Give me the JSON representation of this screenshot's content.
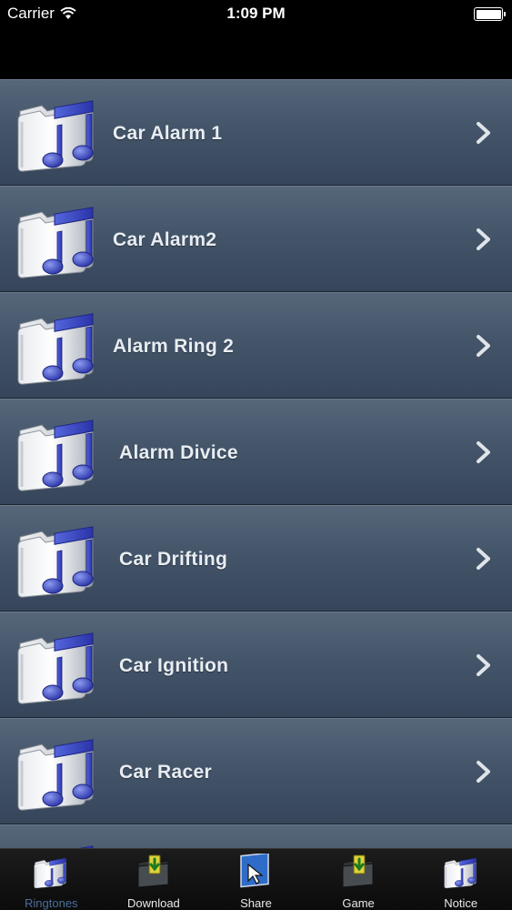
{
  "status_bar": {
    "carrier": "Carrier",
    "time": "1:09 PM",
    "icons": {
      "wifi": "wifi-icon",
      "battery": "battery-icon"
    }
  },
  "list": {
    "items": [
      {
        "label": "Car Alarm 1",
        "icon": "music-folder-icon",
        "chevron": "chevron-right-icon"
      },
      {
        "label": "Car Alarm2",
        "icon": "music-folder-icon",
        "chevron": "chevron-right-icon"
      },
      {
        "label": "Alarm Ring 2",
        "icon": "music-folder-icon",
        "chevron": "chevron-right-icon"
      },
      {
        "label": "Alarm Divice",
        "icon": "music-folder-icon",
        "chevron": "chevron-right-icon"
      },
      {
        "label": "Car Drifting",
        "icon": "music-folder-icon",
        "chevron": "chevron-right-icon"
      },
      {
        "label": "Car Ignition",
        "icon": "music-folder-icon",
        "chevron": "chevron-right-icon"
      },
      {
        "label": "Car Racer",
        "icon": "music-folder-icon",
        "chevron": "chevron-right-icon"
      },
      {
        "label": "",
        "icon": "music-folder-icon",
        "chevron": "chevron-right-icon"
      }
    ]
  },
  "tab_bar": {
    "active": "Ringtones",
    "tabs": [
      {
        "label": "Ringtones",
        "icon": "music-folder-icon"
      },
      {
        "label": "Download",
        "icon": "download-folder-icon"
      },
      {
        "label": "Share",
        "icon": "cursor-share-icon"
      },
      {
        "label": "Game",
        "icon": "download-folder-icon"
      },
      {
        "label": "Notice",
        "icon": "music-folder-icon"
      }
    ]
  },
  "colors": {
    "row_top": "#56677a",
    "row_bottom": "#36455a",
    "note_blue": "#3a46c8",
    "tab_active": "#4a6e9a"
  }
}
